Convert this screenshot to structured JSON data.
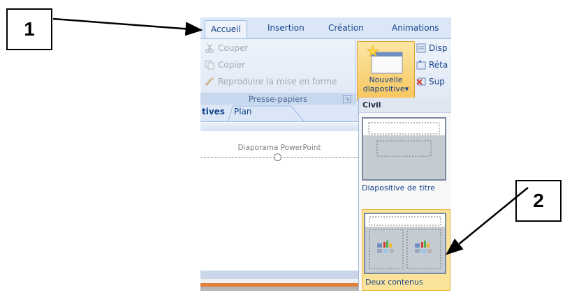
{
  "callouts": [
    "1",
    "2"
  ],
  "tabs": [
    {
      "label": "Accueil",
      "active": true
    },
    {
      "label": "Insertion",
      "active": false
    },
    {
      "label": "Création",
      "active": false
    },
    {
      "label": "Animations",
      "active": false
    }
  ],
  "clipboard": {
    "items": [
      "Couper",
      "Copier",
      "Reproduire la mise en forme"
    ],
    "group_label": "Presse-papiers",
    "launcher_icon": "dialog-launcher-icon"
  },
  "slides_group": {
    "new_slide_label_line1": "Nouvelle",
    "new_slide_label_line2": "diapositive",
    "dropdown_arrow": "▾",
    "cmd_layout": "Disp",
    "cmd_reset": "Réta",
    "cmd_delete": "Sup"
  },
  "left_pane": {
    "tab_slides": "tives",
    "tab_outline": "Plan",
    "slide_title": "Diaporama PowerPoint"
  },
  "layout_gallery": {
    "header": "Civil",
    "layouts": [
      {
        "label": "Diapositive de titre",
        "selected": false
      },
      {
        "label": "Deux contenus",
        "selected": true
      }
    ]
  },
  "colors": {
    "tab_text": "#15428b",
    "ribbon_bg": "#dfe8f5",
    "selected_layout": "#fbe39a",
    "disabled_text": "#a2aab5"
  }
}
